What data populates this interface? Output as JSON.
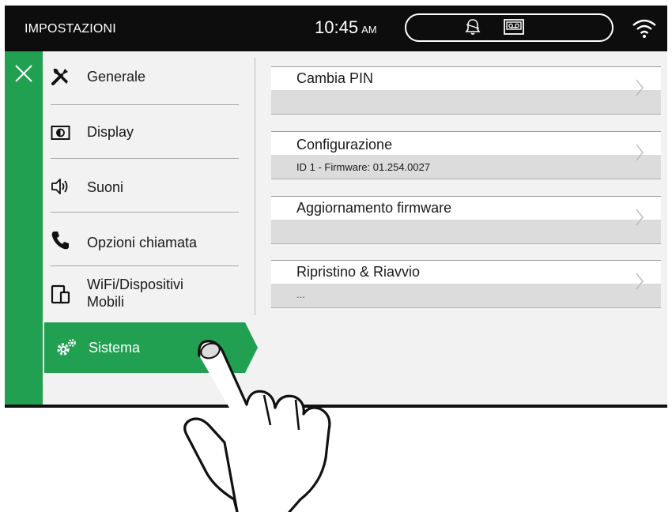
{
  "header": {
    "title": "IMPOSTAZIONI",
    "time": "10:45",
    "ampm": "AM",
    "icons": [
      "bell-icon",
      "answering-machine-icon",
      "wifi-icon"
    ]
  },
  "sidebar": {
    "close_icon": "close-icon",
    "items": [
      {
        "label": "Generale",
        "icon": "wrench-screwdriver-icon"
      },
      {
        "label": "Display",
        "icon": "display-icon"
      },
      {
        "label": "Suoni",
        "icon": "speaker-icon"
      },
      {
        "label": "Opzioni chiamata",
        "icon": "phone-icon"
      },
      {
        "label": "WiFi/Dispositivi\nMobili",
        "label_line1": "WiFi/Dispositivi",
        "label_line2": "Mobili",
        "icon": "mobile-device-icon"
      },
      {
        "label": "Sistema",
        "icon": "gears-icon",
        "selected": true
      }
    ]
  },
  "settings": {
    "rows": [
      {
        "title": "Cambia PIN",
        "subtitle": ""
      },
      {
        "title": "Configurazione",
        "subtitle": "ID 1 - Firmware: 01.254.0027"
      },
      {
        "title": "Aggiornamento firmware",
        "subtitle": ""
      },
      {
        "title": "Ripristino & Riavvio",
        "subtitle": "..."
      }
    ]
  },
  "colors": {
    "accent": "#21a051",
    "topbar": "#0d0d0d",
    "panel": "#f2f2f2",
    "subtitle_band": "#dcdcdc"
  }
}
